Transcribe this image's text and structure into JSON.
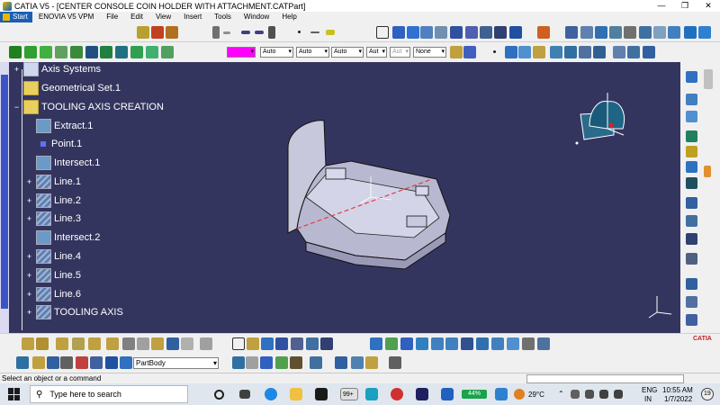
{
  "window": {
    "title": "CATIA V5 - [CENTER CONSOLE COIN HOLDER WITH ATTACHMENT.CATPart]",
    "minimize": "—",
    "restore": "❐",
    "close": "✕"
  },
  "menubar": {
    "start": "Start",
    "items": [
      "ENOVIA V5 VPM",
      "File",
      "Edit",
      "View",
      "Insert",
      "Tools",
      "Window",
      "Help"
    ]
  },
  "toolbar2": {
    "color_value": "",
    "linetype1": "Auto",
    "linetype2": "Auto",
    "linetype3": "Auto",
    "linetype4": "Aut",
    "linetype5": "Aut",
    "layer": "None"
  },
  "tree": {
    "items": [
      {
        "label": "Axis Systems",
        "icon": "axis-systems-icon"
      },
      {
        "label": "Geometrical Set.1",
        "icon": "geometrical-set-icon"
      },
      {
        "label": "TOOLING AXIS CREATION",
        "icon": "geometrical-set-icon"
      },
      {
        "label": "Extract.1",
        "icon": "extract-icon"
      },
      {
        "label": "Point.1",
        "icon": "point-icon"
      },
      {
        "label": "Intersect.1",
        "icon": "intersect-icon"
      },
      {
        "label": "Line.1",
        "icon": "line-icon"
      },
      {
        "label": "Line.2",
        "icon": "line-icon"
      },
      {
        "label": "Line.3",
        "icon": "line-icon"
      },
      {
        "label": "Intersect.2",
        "icon": "intersect-icon"
      },
      {
        "label": "Line.4",
        "icon": "line-icon"
      },
      {
        "label": "Line.5",
        "icon": "line-icon"
      },
      {
        "label": "Line.6",
        "icon": "line-icon"
      },
      {
        "label": "TOOLING AXIS",
        "icon": "line-icon"
      }
    ]
  },
  "bottom_toolbar": {
    "partbody": "PartBody",
    "catia_logo": "CATIA"
  },
  "statusbar": {
    "message": "Select an object or a command"
  },
  "taskbar": {
    "search_placeholder": "Type here to search",
    "badge": "99+",
    "battery": "44%",
    "temperature": "29°C",
    "language": "ENG",
    "region": "IN",
    "time": "10:55 AM",
    "date": "1/7/2022",
    "notifications": "19"
  },
  "colors": {
    "viewport_bg": "#34355f",
    "tree_text": "#ffffff",
    "accent": "#1a5fb4",
    "magenta": "#ff00ff"
  }
}
